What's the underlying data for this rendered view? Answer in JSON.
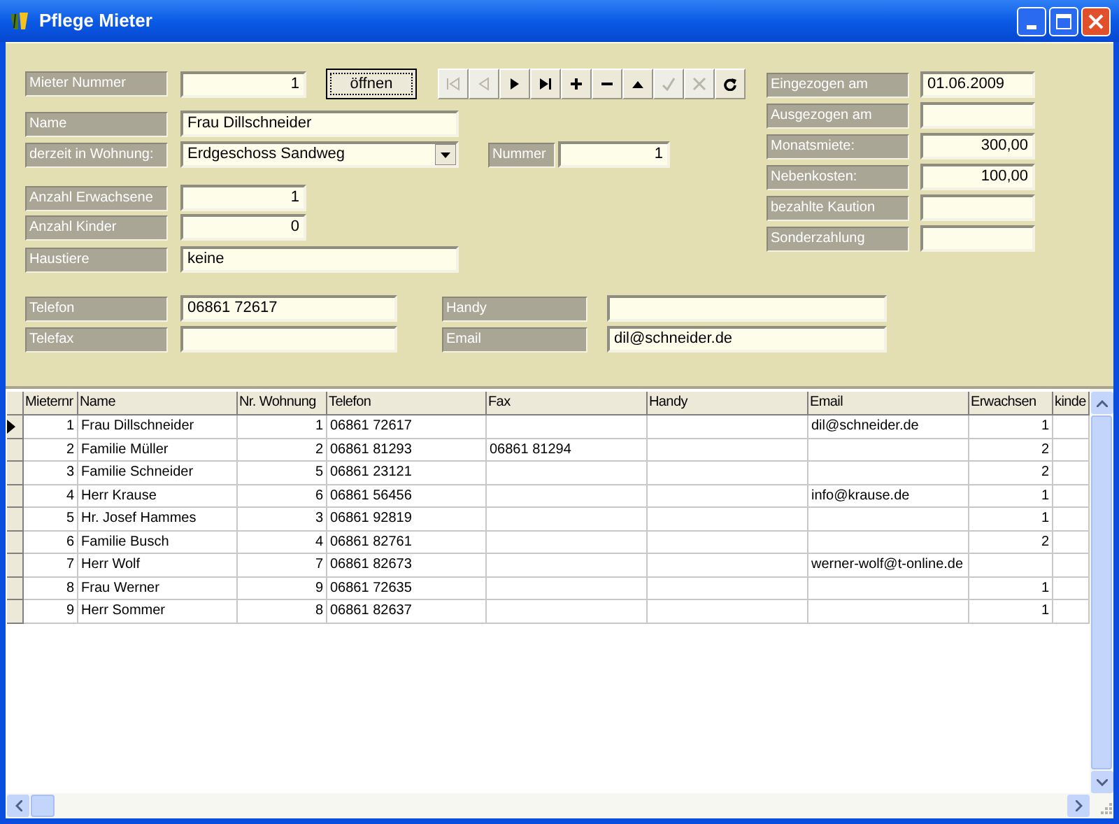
{
  "window": {
    "title": "Pflege Mieter"
  },
  "tenant_number": {
    "label": "Mieter Nummer",
    "value": "1"
  },
  "open_button": "öffnen",
  "navigator": [
    {
      "kind": "first",
      "disabled": true
    },
    {
      "kind": "prior",
      "disabled": true
    },
    {
      "kind": "next",
      "disabled": false
    },
    {
      "kind": "last",
      "disabled": false
    },
    {
      "kind": "insert",
      "disabled": false
    },
    {
      "kind": "delete",
      "disabled": false
    },
    {
      "kind": "edit",
      "disabled": false
    },
    {
      "kind": "post",
      "disabled": true
    },
    {
      "kind": "cancel",
      "disabled": true
    },
    {
      "kind": "refresh",
      "disabled": false
    }
  ],
  "name": {
    "label": "Name",
    "value": "Frau Dillschneider"
  },
  "apartment": {
    "label": "derzeit in Wohnung:",
    "value": "Erdgeschoss Sandweg"
  },
  "apartment_number": {
    "label": "Nummer",
    "value": "1"
  },
  "adults": {
    "label": "Anzahl Erwachsene",
    "value": "1"
  },
  "children": {
    "label": "Anzahl Kinder",
    "value": "0"
  },
  "pets": {
    "label": "Haustiere",
    "value": "keine"
  },
  "contact": [
    {
      "label": "Telefon",
      "value": "06861 72617"
    },
    {
      "label": "Handy"
    },
    {
      "label": "Telefax"
    },
    {
      "label": "Email",
      "value": "dil@schneider.de"
    }
  ],
  "details": [
    {
      "label": "Eingezogen am",
      "value": "01.06.2009",
      "kind": "text"
    },
    {
      "label": "Ausgezogen am",
      "kind": "text"
    },
    {
      "label": "Monatsmiete:",
      "value": "300,00",
      "kind": "number"
    },
    {
      "label": "Nebenkosten:",
      "value": "100,00",
      "kind": "number"
    },
    {
      "label": "bezahlte Kaution",
      "kind": "number"
    },
    {
      "label": "Sonderzahlung",
      "kind": "number"
    }
  ],
  "table": {
    "columns": [
      "Mieternr",
      "Name",
      "Nr. Wohnung",
      "Telefon",
      "Fax",
      "Handy",
      "Email",
      "Erwachsen",
      "kinde"
    ],
    "rows": [
      {
        "selected": true,
        "mieternr": "1",
        "name": "Frau Dillschneider",
        "nr_wohnung": "1",
        "telefon": "06861 72617",
        "email": "dil@schneider.de",
        "erwachsene": "1"
      },
      {
        "selected": false,
        "mieternr": "2",
        "name": "Familie Müller",
        "nr_wohnung": "2",
        "telefon": "06861 81293",
        "fax": "06861 81294",
        "erwachsene": "2"
      },
      {
        "selected": false,
        "mieternr": "3",
        "name": "Familie Schneider",
        "nr_wohnung": "5",
        "telefon": "06861 23121",
        "erwachsene": "2"
      },
      {
        "selected": false,
        "mieternr": "4",
        "name": "Herr Krause",
        "nr_wohnung": "6",
        "telefon": "06861 56456",
        "email": "info@krause.de",
        "erwachsene": "1"
      },
      {
        "selected": false,
        "mieternr": "5",
        "name": "Hr. Josef Hammes",
        "nr_wohnung": "3",
        "telefon": "06861 92819",
        "erwachsene": "1"
      },
      {
        "selected": false,
        "mieternr": "6",
        "name": "Familie Busch",
        "nr_wohnung": "4",
        "telefon": "06861 82761",
        "erwachsene": "2"
      },
      {
        "selected": false,
        "mieternr": "7",
        "name": "Herr Wolf",
        "nr_wohnung": "7",
        "telefon": "06861 82673",
        "email": "werner-wolf@t-online.de"
      },
      {
        "selected": false,
        "mieternr": "8",
        "name": "Frau Werner",
        "nr_wohnung": "9",
        "telefon": "06861 72635",
        "erwachsene": "1"
      },
      {
        "selected": false,
        "mieternr": "9",
        "name": "Herr Sommer",
        "nr_wohnung": "8",
        "telefon": "06861 82637",
        "erwachsene": "1"
      }
    ]
  }
}
